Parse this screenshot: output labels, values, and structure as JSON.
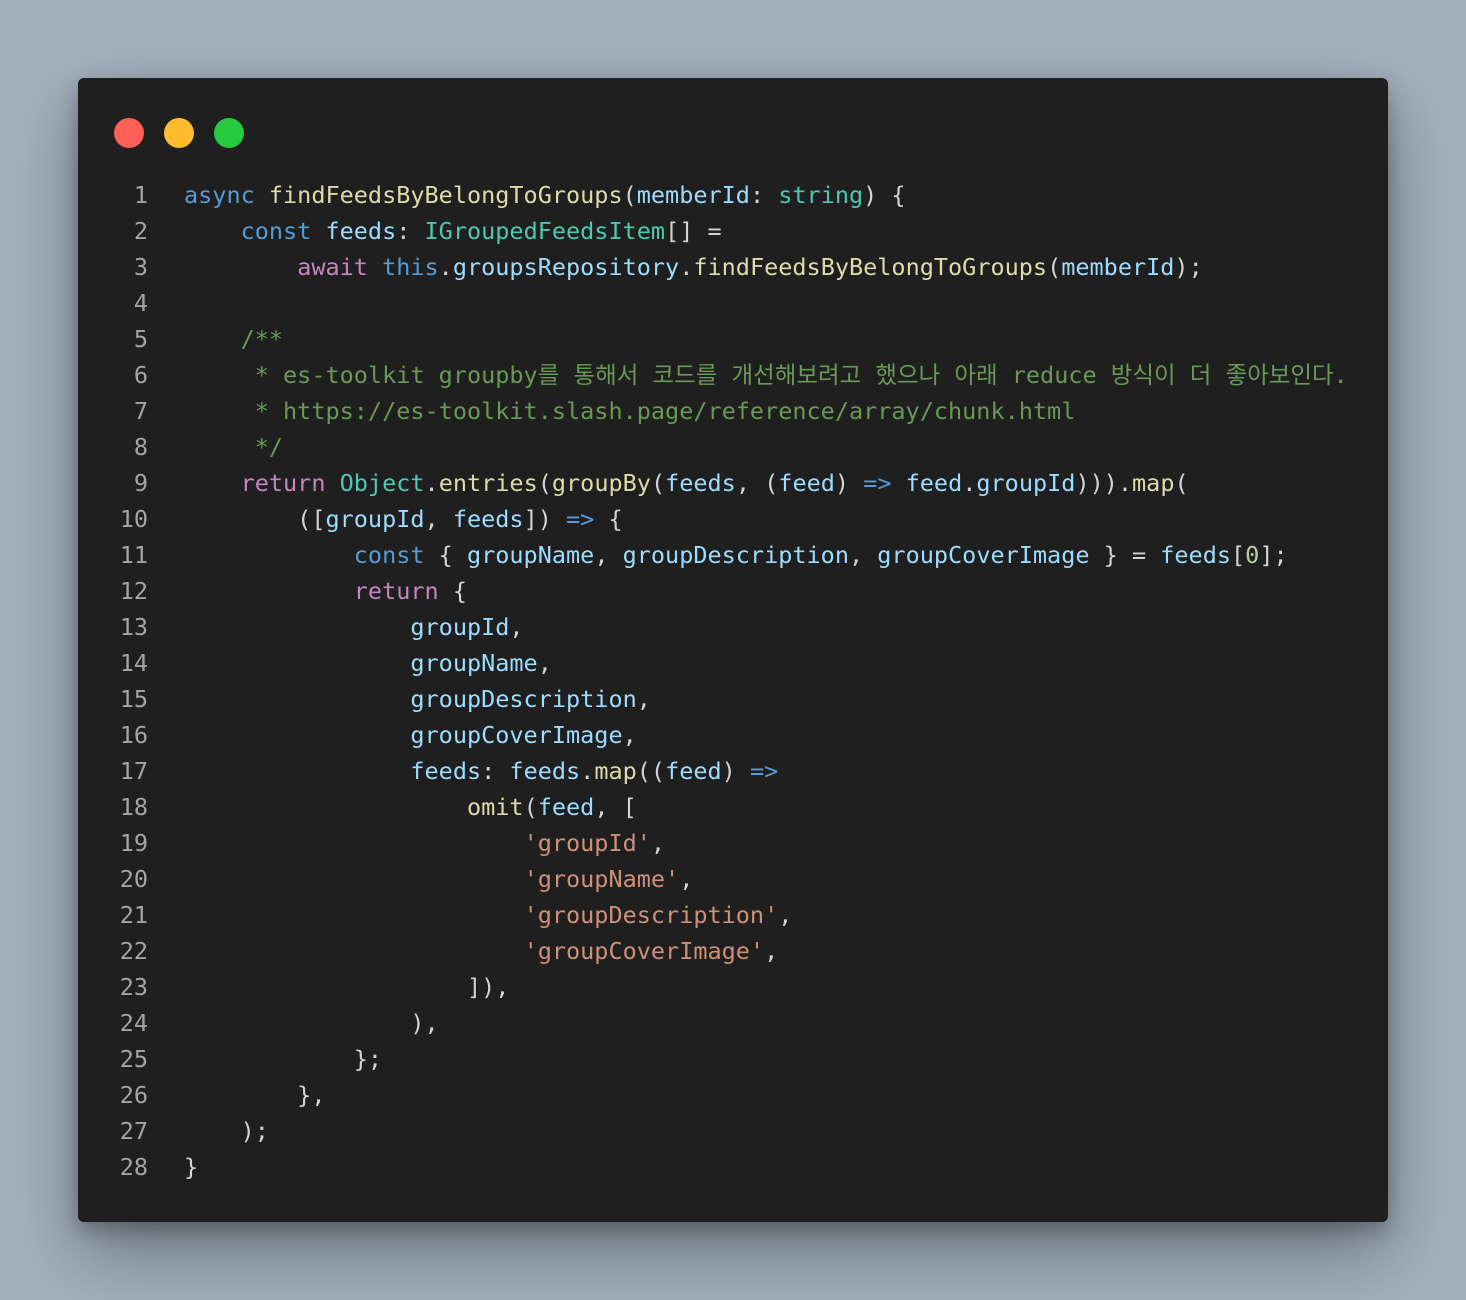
{
  "window": {
    "controls": [
      "close",
      "minimize",
      "maximize"
    ]
  },
  "editor": {
    "language": "typescript",
    "lines": [
      [
        [
          "kw",
          "async "
        ],
        [
          "fn",
          "findFeedsByBelongToGroups"
        ],
        [
          "pn",
          "("
        ],
        [
          "vr",
          "memberId"
        ],
        [
          "pn",
          ": "
        ],
        [
          "ty",
          "string"
        ],
        [
          "pn",
          ") {"
        ]
      ],
      [
        [
          "pn",
          "    "
        ],
        [
          "kw",
          "const "
        ],
        [
          "vr",
          "feeds"
        ],
        [
          "pn",
          ": "
        ],
        [
          "ty",
          "IGroupedFeedsItem"
        ],
        [
          "pn",
          "[] ="
        ]
      ],
      [
        [
          "pn",
          "        "
        ],
        [
          "ctl",
          "await "
        ],
        [
          "kw",
          "this"
        ],
        [
          "pn",
          "."
        ],
        [
          "vr",
          "groupsRepository"
        ],
        [
          "pn",
          "."
        ],
        [
          "fn",
          "findFeedsByBelongToGroups"
        ],
        [
          "pn",
          "("
        ],
        [
          "vr",
          "memberId"
        ],
        [
          "pn",
          ");"
        ]
      ],
      [],
      [
        [
          "pn",
          "    "
        ],
        [
          "cm",
          "/**"
        ]
      ],
      [
        [
          "pn",
          "    "
        ],
        [
          "cm",
          " * es-toolkit groupby를 통해서 코드를 개선해보려고 했으나 아래 reduce 방식이 더 좋아보인다."
        ]
      ],
      [
        [
          "pn",
          "    "
        ],
        [
          "cm",
          " * https://es-toolkit.slash.page/reference/array/chunk.html"
        ]
      ],
      [
        [
          "pn",
          "    "
        ],
        [
          "cm",
          " */"
        ]
      ],
      [
        [
          "pn",
          "    "
        ],
        [
          "ctl",
          "return "
        ],
        [
          "ty",
          "Object"
        ],
        [
          "pn",
          "."
        ],
        [
          "fn",
          "entries"
        ],
        [
          "pn",
          "("
        ],
        [
          "fn",
          "groupBy"
        ],
        [
          "pn",
          "("
        ],
        [
          "vr",
          "feeds"
        ],
        [
          "pn",
          ", ("
        ],
        [
          "vr",
          "feed"
        ],
        [
          "pn",
          ") "
        ],
        [
          "kw",
          "=>"
        ],
        [
          "pn",
          " "
        ],
        [
          "vr",
          "feed"
        ],
        [
          "pn",
          "."
        ],
        [
          "vr",
          "groupId"
        ],
        [
          "pn",
          ")))."
        ],
        [
          "fn",
          "map"
        ],
        [
          "pn",
          "("
        ]
      ],
      [
        [
          "pn",
          "        (["
        ],
        [
          "vr",
          "groupId"
        ],
        [
          "pn",
          ", "
        ],
        [
          "vr",
          "feeds"
        ],
        [
          "pn",
          "]) "
        ],
        [
          "kw",
          "=>"
        ],
        [
          "pn",
          " {"
        ]
      ],
      [
        [
          "pn",
          "            "
        ],
        [
          "kw",
          "const "
        ],
        [
          "pn",
          "{ "
        ],
        [
          "vr",
          "groupName"
        ],
        [
          "pn",
          ", "
        ],
        [
          "vr",
          "groupDescription"
        ],
        [
          "pn",
          ", "
        ],
        [
          "vr",
          "groupCoverImage"
        ],
        [
          "pn",
          " } = "
        ],
        [
          "vr",
          "feeds"
        ],
        [
          "pn",
          "["
        ],
        [
          "num",
          "0"
        ],
        [
          "pn",
          "];"
        ]
      ],
      [
        [
          "pn",
          "            "
        ],
        [
          "ctl",
          "return "
        ],
        [
          "pn",
          "{"
        ]
      ],
      [
        [
          "pn",
          "                "
        ],
        [
          "vr",
          "groupId"
        ],
        [
          "pn",
          ","
        ]
      ],
      [
        [
          "pn",
          "                "
        ],
        [
          "vr",
          "groupName"
        ],
        [
          "pn",
          ","
        ]
      ],
      [
        [
          "pn",
          "                "
        ],
        [
          "vr",
          "groupDescription"
        ],
        [
          "pn",
          ","
        ]
      ],
      [
        [
          "pn",
          "                "
        ],
        [
          "vr",
          "groupCoverImage"
        ],
        [
          "pn",
          ","
        ]
      ],
      [
        [
          "pn",
          "                "
        ],
        [
          "vr",
          "feeds"
        ],
        [
          "pn",
          ": "
        ],
        [
          "vr",
          "feeds"
        ],
        [
          "pn",
          "."
        ],
        [
          "fn",
          "map"
        ],
        [
          "pn",
          "(("
        ],
        [
          "vr",
          "feed"
        ],
        [
          "pn",
          ") "
        ],
        [
          "kw",
          "=>"
        ]
      ],
      [
        [
          "pn",
          "                    "
        ],
        [
          "fn",
          "omit"
        ],
        [
          "pn",
          "("
        ],
        [
          "vr",
          "feed"
        ],
        [
          "pn",
          ", ["
        ]
      ],
      [
        [
          "pn",
          "                        "
        ],
        [
          "str",
          "'groupId'"
        ],
        [
          "pn",
          ","
        ]
      ],
      [
        [
          "pn",
          "                        "
        ],
        [
          "str",
          "'groupName'"
        ],
        [
          "pn",
          ","
        ]
      ],
      [
        [
          "pn",
          "                        "
        ],
        [
          "str",
          "'groupDescription'"
        ],
        [
          "pn",
          ","
        ]
      ],
      [
        [
          "pn",
          "                        "
        ],
        [
          "str",
          "'groupCoverImage'"
        ],
        [
          "pn",
          ","
        ]
      ],
      [
        [
          "pn",
          "                    ]),"
        ]
      ],
      [
        [
          "pn",
          "                ),"
        ]
      ],
      [
        [
          "pn",
          "            };"
        ]
      ],
      [
        [
          "pn",
          "        },"
        ]
      ],
      [
        [
          "pn",
          "    );"
        ]
      ],
      [
        [
          "pn",
          "}"
        ]
      ]
    ]
  }
}
